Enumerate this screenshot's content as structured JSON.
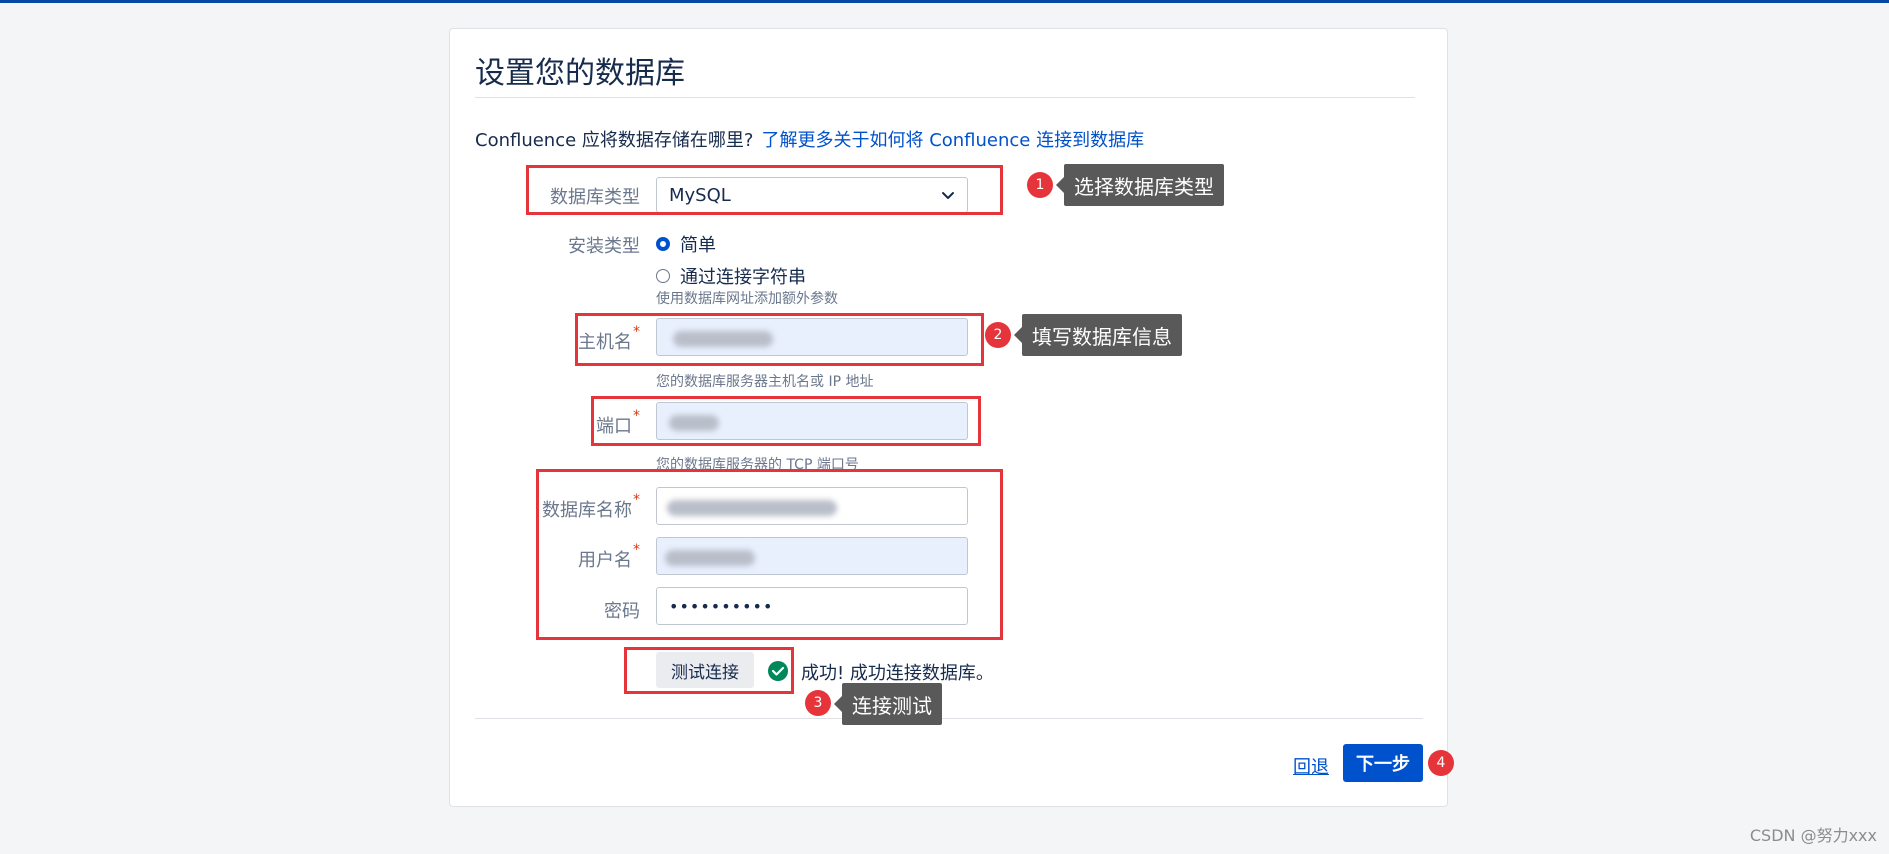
{
  "page": {
    "title": "设置您的数据库",
    "question": "Confluence 应将数据存储在哪里?",
    "learn_more_link": "了解更多关于如何将 Confluence 连接到数据库"
  },
  "form": {
    "db_type": {
      "label": "数据库类型",
      "value": "MySQL"
    },
    "install_type": {
      "label": "安装类型",
      "options": [
        {
          "label": "简单",
          "checked": true
        },
        {
          "label": "通过连接字符串",
          "checked": false
        }
      ],
      "hint": "使用数据库网址添加额外参数"
    },
    "hostname": {
      "label": "主机名",
      "required_mark": "*",
      "hint": "您的数据库服务器主机名或 IP 地址"
    },
    "port": {
      "label": "端口",
      "required_mark": "*",
      "hint": "您的数据库服务器的 TCP 端口号"
    },
    "db_name": {
      "label": "数据库名称",
      "required_mark": "*"
    },
    "username": {
      "label": "用户名",
      "required_mark": "*"
    },
    "password": {
      "label": "密码",
      "value": "••••••••••"
    }
  },
  "test": {
    "button_label": "测试连接",
    "result": "成功!  成功连接数据库。"
  },
  "footer": {
    "back_label": "回退",
    "next_label": "下一步"
  },
  "annotations": [
    {
      "number": "1",
      "text": "选择数据库类型"
    },
    {
      "number": "2",
      "text": "填写数据库信息"
    },
    {
      "number": "3",
      "text": "连接测试"
    },
    {
      "number": "4"
    }
  ],
  "watermark": "CSDN @努力xxx",
  "colors": {
    "primary": "#0052cc",
    "annotation_red": "#e5343a",
    "success_green": "#00875a",
    "tooltip_gray": "#595959",
    "autofill_blue": "#e8f0fe"
  }
}
